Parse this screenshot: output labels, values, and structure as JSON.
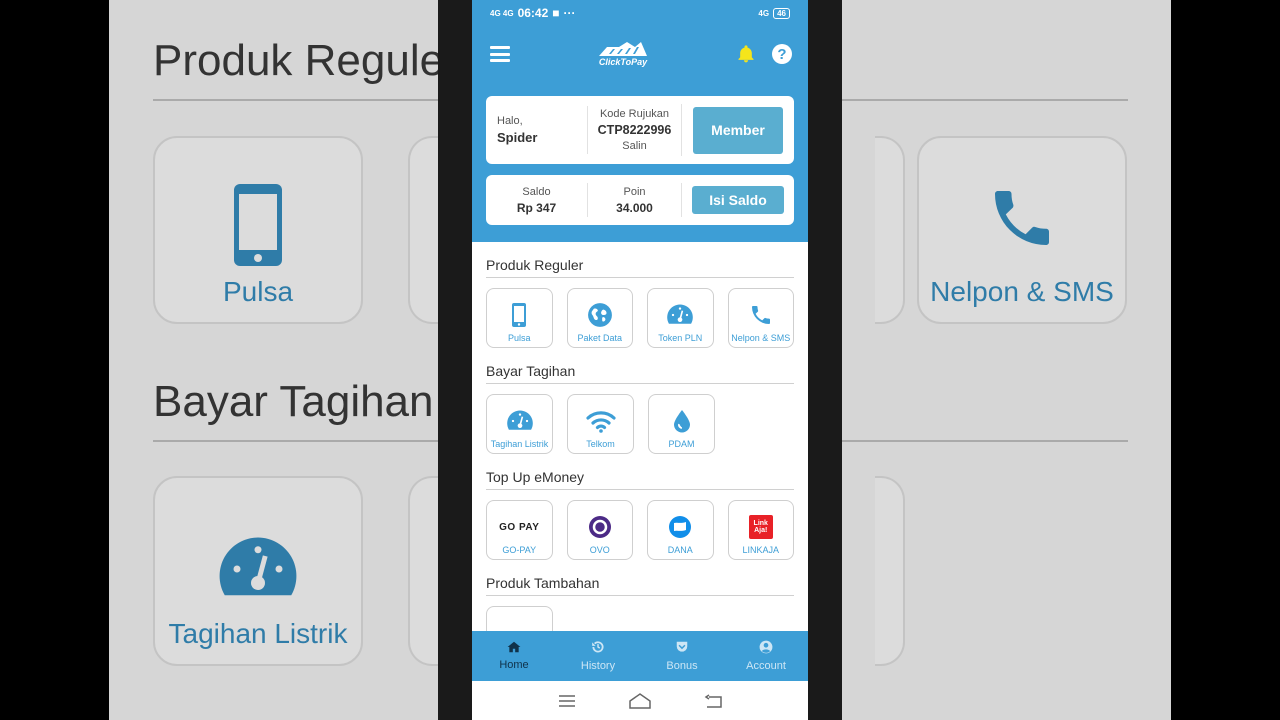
{
  "background": {
    "section1_title": "Produk Reguler",
    "section2_title": "Bayar Tagihan",
    "card_pulsa": "Pulsa",
    "card_nelpon": "Nelpon & SMS",
    "card_tagihan": "Tagihan Listrik"
  },
  "status": {
    "network": "4G 4G",
    "time": "06:42",
    "dots": "···",
    "right_network": "4G",
    "battery": "46"
  },
  "header": {
    "brand": "ClickToPay"
  },
  "user_card": {
    "greeting": "Halo,",
    "name": "Spider",
    "ref_label": "Kode Rujukan",
    "ref_code": "CTP8222996",
    "copy_label": "Salin",
    "member_button": "Member"
  },
  "balance_card": {
    "saldo_label": "Saldo",
    "saldo_value": "Rp 347",
    "poin_label": "Poin",
    "poin_value": "34.000",
    "topup_button": "Isi Saldo"
  },
  "sections": {
    "reguler": {
      "title": "Produk Reguler",
      "items": [
        "Pulsa",
        "Paket Data",
        "Token PLN",
        "Nelpon & SMS"
      ]
    },
    "tagihan": {
      "title": "Bayar Tagihan",
      "items": [
        "Tagihan Listrik",
        "Telkom",
        "PDAM"
      ]
    },
    "emoney": {
      "title": "Top Up eMoney",
      "items": [
        "GO-PAY",
        "OVO",
        "DANA",
        "LINKAJA"
      ],
      "gopay_logo": "GO PAY",
      "linkaja_logo": "Link Aja!"
    },
    "tambahan": {
      "title": "Produk Tambahan"
    }
  },
  "bottom_nav": {
    "items": [
      "Home",
      "History",
      "Bonus",
      "Account"
    ]
  },
  "colors": {
    "primary": "#3d9ed6",
    "button": "#5aaed0",
    "bell": "#f5e51b"
  }
}
